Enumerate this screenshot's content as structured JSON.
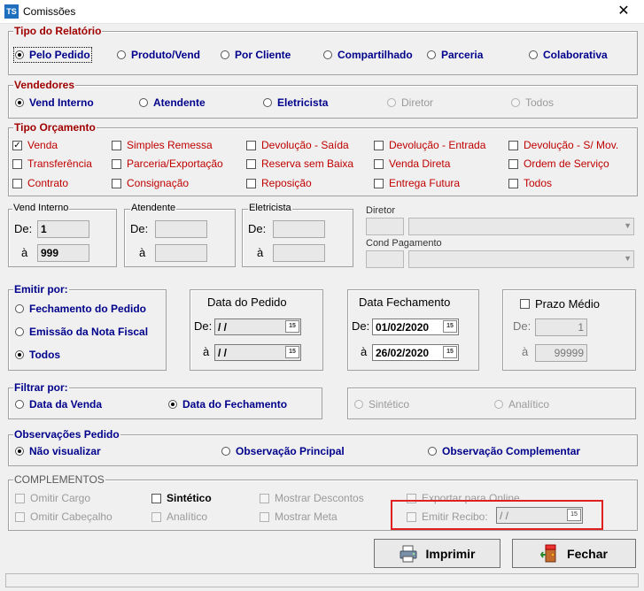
{
  "window": {
    "title": "Comissões",
    "app_icon_text": "TS"
  },
  "tipo_relatorio": {
    "legend": "Tipo do Relatório",
    "options": [
      "Pelo Pedido",
      "Produto/Vend",
      "Por Cliente",
      "Compartilhado",
      "Parceria",
      "Colaborativa"
    ],
    "selected": "Pelo Pedido"
  },
  "vendedores": {
    "legend": "Vendedores",
    "options": [
      "Vend Interno",
      "Atendente",
      "Eletricista",
      "Diretor",
      "Todos"
    ],
    "selected": "Vend Interno"
  },
  "tipo_orcamento": {
    "legend": "Tipo Orçamento",
    "items": [
      "Venda",
      "Simples Remessa",
      "Devolução - Saída",
      "Devolução - Entrada",
      "Devolução - S/ Mov.",
      "Transferência",
      "Parceria/Exportação",
      "Reserva sem Baixa",
      "Venda Direta",
      "Ordem de Serviço",
      "Contrato",
      "Consignação",
      "Reposição",
      "Entrega Futura",
      "Todos"
    ],
    "checked": [
      "Venda"
    ]
  },
  "vend_interno": {
    "legend": "Vend Interno",
    "de_label": "De:",
    "a_label": "à",
    "de": "1",
    "a": "999"
  },
  "atendente": {
    "legend": "Atendente",
    "de_label": "De:",
    "a_label": "à",
    "de": "",
    "a": ""
  },
  "eletricista": {
    "legend": "Eletricista",
    "de_label": "De:",
    "a_label": "à",
    "de": "",
    "a": ""
  },
  "diretor": {
    "label": "Diretor"
  },
  "cond_pagamento": {
    "label": "Cond Pagamento"
  },
  "emitir_por": {
    "legend": "Emitir por:",
    "options": [
      "Fechamento do Pedido",
      "Emissão da Nota Fiscal",
      "Todos"
    ],
    "selected": "Todos"
  },
  "data_pedido": {
    "title": "Data do Pedido",
    "de_label": "De:",
    "a_label": "à",
    "de": " /  /",
    "a": " /  /"
  },
  "data_fechamento": {
    "title": "Data Fechamento",
    "de_label": "De:",
    "a_label": "à",
    "de": "01/02/2020",
    "a": "26/02/2020"
  },
  "prazo_medio": {
    "label": "Prazo Médio",
    "de_label": "De:",
    "a_label": "à",
    "de": "1",
    "a": "99999"
  },
  "filtrar_por": {
    "legend": "Filtrar por:",
    "options": [
      "Data da Venda",
      "Data do Fechamento"
    ],
    "selected": "Data do Fechamento"
  },
  "sint_anal": {
    "options": [
      "Sintético",
      "Analítico"
    ]
  },
  "obs_pedido": {
    "legend": "Observações Pedido",
    "options": [
      "Não visualizar",
      "Observação Principal",
      "Observação Complementar"
    ],
    "selected": "Não visualizar"
  },
  "complementos": {
    "legend": "COMPLEMENTOS",
    "items": [
      "Omitir Cargo",
      "Sintético",
      "Mostrar Descontos",
      "Exportar para Online",
      "Omitir Cabeçalho",
      "Analítico",
      "Mostrar Meta",
      "Emitir Recibo:"
    ],
    "recibo_date": " /  /"
  },
  "buttons": {
    "imprimir": "Imprimir",
    "fechar": "Fechar"
  },
  "icons": {
    "app": "ts-app-icon",
    "close": "close-icon",
    "printer": "printer-icon",
    "exit": "exit-door-icon",
    "calendar": "calendar-icon"
  },
  "colors": {
    "legend_red": "#a00000",
    "option_blue": "#00008b",
    "option_red": "#c00000",
    "highlight": "#e02020"
  }
}
